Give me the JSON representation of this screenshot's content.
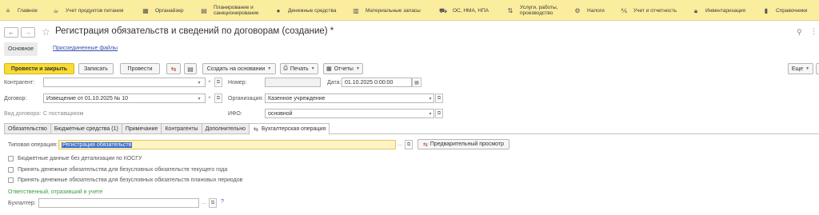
{
  "sections": [
    {
      "label": "Главное",
      "icon": "menu-icon"
    },
    {
      "label": "Учет продуктов питания",
      "icon": "food-icon"
    },
    {
      "label": "Органайзер",
      "icon": "calendar-icon"
    },
    {
      "label": "Планирование и санкционирование",
      "icon": "planning-icon"
    },
    {
      "label": "Денежные средства",
      "icon": "money-icon"
    },
    {
      "label": "Материальные запасы",
      "icon": "inventory-icon"
    },
    {
      "label": "ОС, НМА, НПА",
      "icon": "truck-icon"
    },
    {
      "label": "Услуги, работы, производство",
      "icon": "services-icon"
    },
    {
      "label": "Налоги",
      "icon": "taxes-icon"
    },
    {
      "label": "Учет и отчетность",
      "icon": "reporting-icon"
    },
    {
      "label": "Инвентаризация",
      "icon": "lock-icon"
    },
    {
      "label": "Справочники",
      "icon": "book-icon"
    }
  ],
  "title": "Регистрация обязательств и сведений по договорам (создание) *",
  "nav": {
    "back": "←",
    "forward": "→",
    "star": "☆",
    "link_icon": "link-icon",
    "menu_icon": "more-icon"
  },
  "form_tabs": {
    "main": "Основное",
    "attached": "Присоединенные файлы"
  },
  "commands": {
    "post_close": "Провести и закрыть",
    "save": "Записать",
    "post": "Провести",
    "create_based": "Создать на основании",
    "print": "Печать",
    "reports": "Отчеты",
    "more": "Еще"
  },
  "fields": {
    "contractor_label": "Контрагент:",
    "contractor_value": "",
    "number_label": "Номер:",
    "number_value": "",
    "date_label": "Дата:",
    "date_value": "01.10.2025  0:00:00",
    "contract_label": "Договор:",
    "contract_value": "Извещение от 01.10.2025 № 10",
    "org_label": "Организация:",
    "org_value": "Казенное учреждение",
    "contract_type_label": "Вид договора:",
    "contract_type_value": "С поставщиком",
    "ifo_label": "ИФО:",
    "ifo_value": "основной"
  },
  "tabs": [
    "Обязательство",
    "Бюджетные средства (1)",
    "Примечание",
    "Контрагенты",
    "Дополнительно",
    "Бухгалтерская операция"
  ],
  "active_tab": "Бухгалтерская операция",
  "operation": {
    "label": "Типовая операция:",
    "value": "Регистрация обязательств",
    "preview_button": "Предварительный просмотр"
  },
  "checkboxes": [
    {
      "label": "Бюджетные данные без детализации по КОСГУ",
      "checked": false
    },
    {
      "label": "Принять денежные обязательства для безусловных обязательств текущего года",
      "checked": false
    },
    {
      "label": "Принять денежные обязательства для безусловных обязательств плановых периодов",
      "checked": false
    }
  ],
  "responsible_heading": "Ответственный, отразивший в учете",
  "accountant": {
    "label": "Бухгалтер:",
    "value": "",
    "help": "?"
  }
}
